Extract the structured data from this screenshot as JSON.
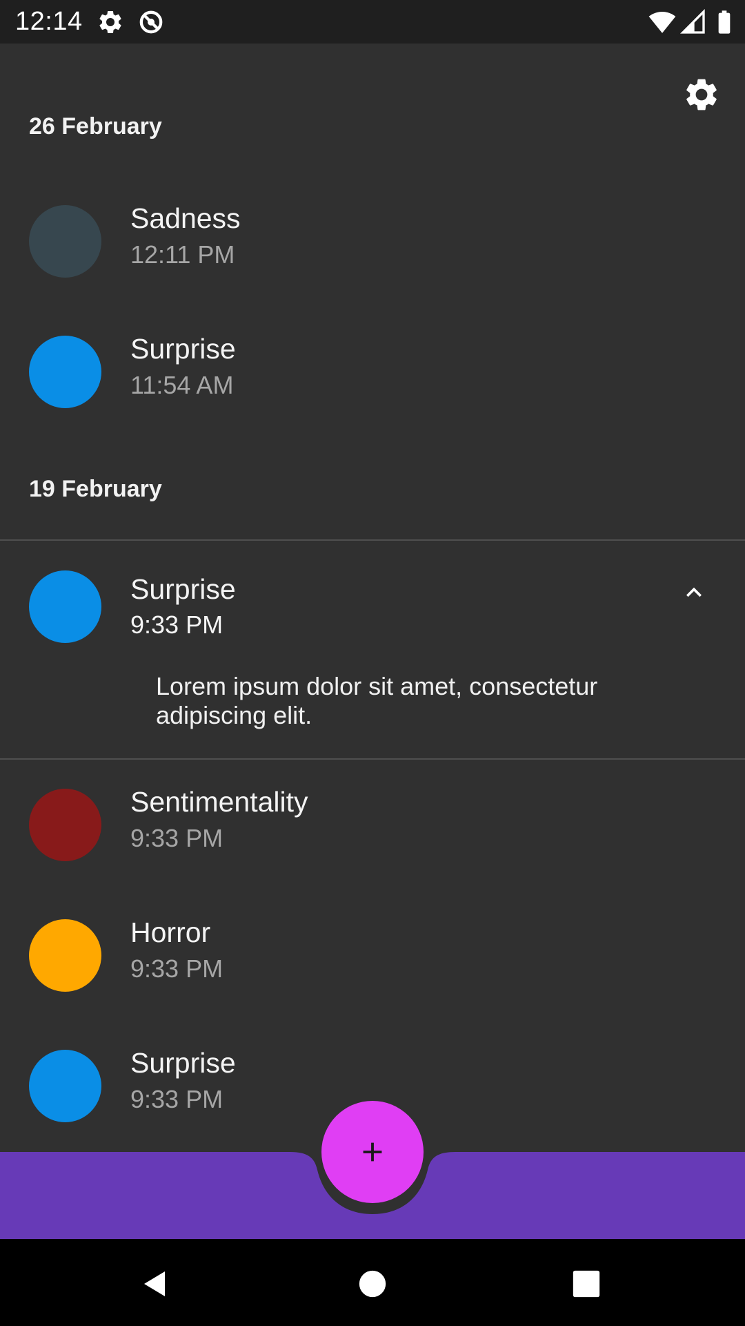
{
  "status_bar": {
    "time": "12:14",
    "icons": [
      "settings-gear-icon",
      "data-saver-icon",
      "wifi-icon",
      "cell-signal-icon",
      "battery-icon"
    ]
  },
  "settings_icon": "gear-icon",
  "groups": [
    {
      "date": "26 February",
      "entries": [
        {
          "emotion": "Sadness",
          "time": "12:11 PM",
          "color": "#37474f"
        },
        {
          "emotion": "Surprise",
          "time": "11:54 AM",
          "color": "#0a8ee6"
        }
      ]
    },
    {
      "date": "19 February",
      "entries": [
        {
          "emotion": "Surprise",
          "time": "9:33 PM",
          "color": "#0a8ee6",
          "expanded": true,
          "note": "Lorem ipsum dolor sit amet, consectetur adipiscing elit."
        },
        {
          "emotion": "Sentimentality",
          "time": "9:33 PM",
          "color": "#881a1a"
        },
        {
          "emotion": "Horror",
          "time": "9:33 PM",
          "color": "#ffa800"
        },
        {
          "emotion": "Surprise",
          "time": "9:33 PM",
          "color": "#0a8ee6"
        }
      ]
    }
  ],
  "fab": {
    "icon": "plus-icon",
    "color": "#e03ef4"
  },
  "bottom_bar": {
    "color": "#673ab7"
  },
  "nav_bar": {
    "icons": [
      "back-icon",
      "home-icon",
      "recents-icon"
    ]
  }
}
